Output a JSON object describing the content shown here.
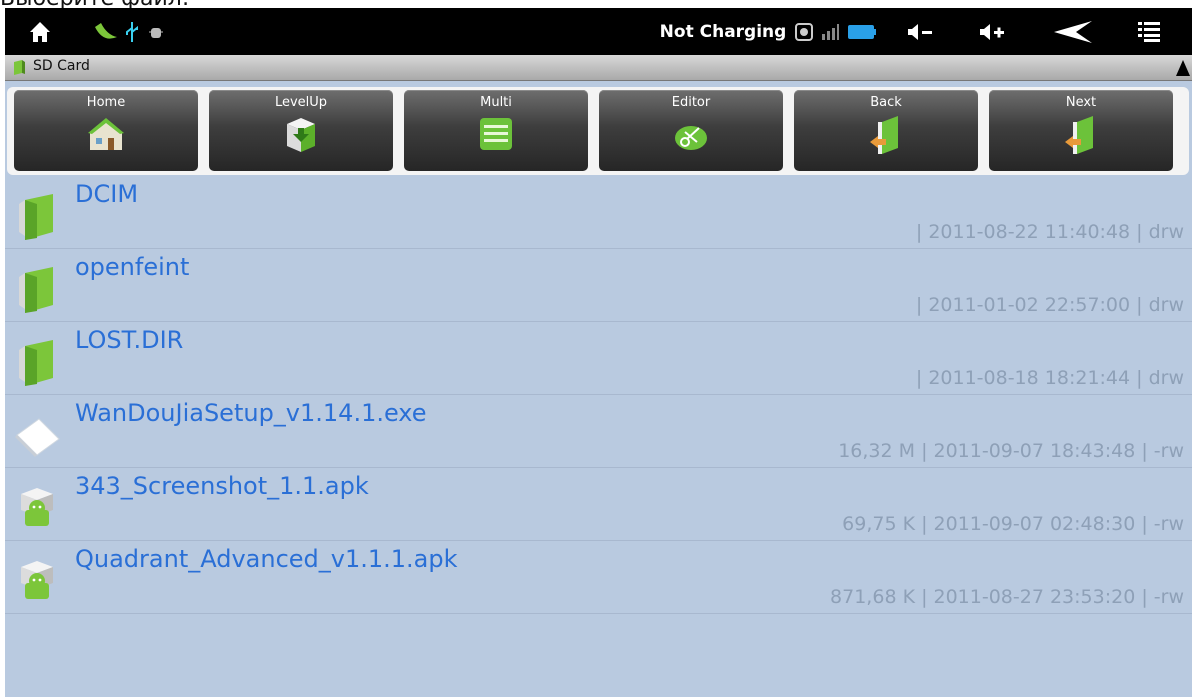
{
  "caption": "Выберите файл:",
  "status_bar": {
    "charging_text": "Not Charging",
    "icons": [
      "home-icon",
      "app-icon",
      "usb-icon",
      "debug-icon",
      "sd-icon",
      "signal-icon",
      "battery-icon",
      "volume-down-icon",
      "volume-up-icon",
      "back-icon",
      "menu-icon"
    ]
  },
  "path": {
    "label": "SD Card"
  },
  "toolbar": {
    "buttons": [
      {
        "label": "Home",
        "icon": "house-icon"
      },
      {
        "label": "LevelUp",
        "icon": "box-up-icon"
      },
      {
        "label": "Multi",
        "icon": "stack-icon"
      },
      {
        "label": "Editor",
        "icon": "scissors-icon"
      },
      {
        "label": "Back",
        "icon": "door-back-icon"
      },
      {
        "label": "Next",
        "icon": "door-next-icon"
      }
    ]
  },
  "files": [
    {
      "name": "DCIM",
      "meta": "| 2011-08-22 11:40:48 | drw",
      "type": "folder"
    },
    {
      "name": "openfeint",
      "meta": "| 2011-01-02 22:57:00 | drw",
      "type": "folder"
    },
    {
      "name": "LOST.DIR",
      "meta": "| 2011-08-18 18:21:44 | drw",
      "type": "folder"
    },
    {
      "name": "WanDouJiaSetup_v1.14.1.exe",
      "meta": "16,32 M | 2011-09-07 18:43:48 | -rw",
      "type": "file"
    },
    {
      "name": "343_Screenshot_1.1.apk",
      "meta": "69,75 K | 2011-09-07 02:48:30 | -rw",
      "type": "apk"
    },
    {
      "name": "Quadrant_Advanced_v1.1.1.apk",
      "meta": "871,68 K | 2011-08-27 23:53:20 | -rw",
      "type": "apk"
    }
  ],
  "colors": {
    "accent_text": "#2a6fd6",
    "list_bg": "#b9cae0",
    "meta_text": "#8ea0b7",
    "folder_green": "#7cc63a"
  }
}
